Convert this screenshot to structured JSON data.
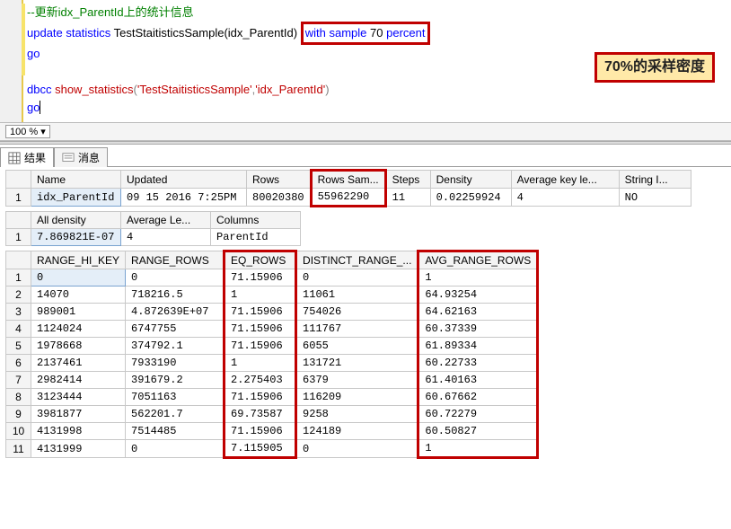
{
  "sql": {
    "comment": "--更新idx_ParentId上的统计信息",
    "l2_update": "update",
    "l2_statistics": "statistics",
    "l2_obj": "TestStaitisticsSample(idx_ParentId)",
    "l2_with": "with",
    "l2_sample": "sample",
    "l2_num": "70",
    "l2_percent": "percent",
    "l3_go": "go",
    "l4_dbcc": "dbcc",
    "l4_fn": "show_statistics",
    "l4_p": "(",
    "l4_s1": "'TestStaitisticsSample'",
    "l4_c": ",",
    "l4_s2": "'idx_ParentId'",
    "l4_p2": ")",
    "l5_go": "go"
  },
  "callout": "70%的采样密度",
  "zoom": "100 %",
  "tabs": {
    "results": "结果",
    "messages": "消息"
  },
  "grid1": {
    "headers": [
      "Name",
      "Updated",
      "Rows",
      "Rows Sam...",
      "Steps",
      "Density",
      "Average key le...",
      "String I..."
    ],
    "rows": [
      [
        "idx_ParentId",
        "09 15 2016  7:25PM",
        "80020380",
        "55962290",
        "11",
        "0.02259924",
        "4",
        "NO"
      ]
    ]
  },
  "grid2": {
    "headers": [
      "All density",
      "Average Le...",
      "Columns"
    ],
    "rows": [
      [
        "7.869821E-07",
        "4",
        "ParentId"
      ]
    ]
  },
  "grid3": {
    "headers": [
      "RANGE_HI_KEY",
      "RANGE_ROWS",
      "EQ_ROWS",
      "DISTINCT_RANGE_...",
      "AVG_RANGE_ROWS"
    ],
    "rows": [
      [
        "0",
        "0",
        "71.15906",
        "0",
        "1"
      ],
      [
        "14070",
        "718216.5",
        "1",
        "11061",
        "64.93254"
      ],
      [
        "989001",
        "4.872639E+07",
        "71.15906",
        "754026",
        "64.62163"
      ],
      [
        "1124024",
        "6747755",
        "71.15906",
        "111767",
        "60.37339"
      ],
      [
        "1978668",
        "374792.1",
        "71.15906",
        "6055",
        "61.89334"
      ],
      [
        "2137461",
        "7933190",
        "1",
        "131721",
        "60.22733"
      ],
      [
        "2982414",
        "391679.2",
        "2.275403",
        "6379",
        "61.40163"
      ],
      [
        "3123444",
        "7051163",
        "71.15906",
        "116209",
        "60.67662"
      ],
      [
        "3981877",
        "562201.7",
        "69.73587",
        "9258",
        "60.72279"
      ],
      [
        "4131998",
        "7514485",
        "71.15906",
        "124189",
        "60.50827"
      ],
      [
        "4131999",
        "0",
        "7.115905",
        "0",
        "1"
      ]
    ]
  },
  "chart_data": {
    "type": "table",
    "stats_header": {
      "Name": "idx_ParentId",
      "Updated": "09 15 2016 7:25PM",
      "Rows": 80020380,
      "Rows Sampled": 55962290,
      "Steps": 11,
      "Density": 0.02259924,
      "Average key length": 4,
      "String Index": "NO"
    },
    "density_vector": {
      "All density": 7.869821e-07,
      "Average Length": 4,
      "Columns": "ParentId"
    },
    "histogram": [
      {
        "RANGE_HI_KEY": 0,
        "RANGE_ROWS": 0,
        "EQ_ROWS": 71.15906,
        "DISTINCT_RANGE_ROWS": 0,
        "AVG_RANGE_ROWS": 1
      },
      {
        "RANGE_HI_KEY": 14070,
        "RANGE_ROWS": 718216.5,
        "EQ_ROWS": 1,
        "DISTINCT_RANGE_ROWS": 11061,
        "AVG_RANGE_ROWS": 64.93254
      },
      {
        "RANGE_HI_KEY": 989001,
        "RANGE_ROWS": 48726390.0,
        "EQ_ROWS": 71.15906,
        "DISTINCT_RANGE_ROWS": 754026,
        "AVG_RANGE_ROWS": 64.62163
      },
      {
        "RANGE_HI_KEY": 1124024,
        "RANGE_ROWS": 6747755,
        "EQ_ROWS": 71.15906,
        "DISTINCT_RANGE_ROWS": 111767,
        "AVG_RANGE_ROWS": 60.37339
      },
      {
        "RANGE_HI_KEY": 1978668,
        "RANGE_ROWS": 374792.1,
        "EQ_ROWS": 71.15906,
        "DISTINCT_RANGE_ROWS": 6055,
        "AVG_RANGE_ROWS": 61.89334
      },
      {
        "RANGE_HI_KEY": 2137461,
        "RANGE_ROWS": 7933190,
        "EQ_ROWS": 1,
        "DISTINCT_RANGE_ROWS": 131721,
        "AVG_RANGE_ROWS": 60.22733
      },
      {
        "RANGE_HI_KEY": 2982414,
        "RANGE_ROWS": 391679.2,
        "EQ_ROWS": 2.275403,
        "DISTINCT_RANGE_ROWS": 6379,
        "AVG_RANGE_ROWS": 61.40163
      },
      {
        "RANGE_HI_KEY": 3123444,
        "RANGE_ROWS": 7051163,
        "EQ_ROWS": 71.15906,
        "DISTINCT_RANGE_ROWS": 116209,
        "AVG_RANGE_ROWS": 60.67662
      },
      {
        "RANGE_HI_KEY": 3981877,
        "RANGE_ROWS": 562201.7,
        "EQ_ROWS": 69.73587,
        "DISTINCT_RANGE_ROWS": 9258,
        "AVG_RANGE_ROWS": 60.72279
      },
      {
        "RANGE_HI_KEY": 4131998,
        "RANGE_ROWS": 7514485,
        "EQ_ROWS": 71.15906,
        "DISTINCT_RANGE_ROWS": 124189,
        "AVG_RANGE_ROWS": 60.50827
      },
      {
        "RANGE_HI_KEY": 4131999,
        "RANGE_ROWS": 0,
        "EQ_ROWS": 7.115905,
        "DISTINCT_RANGE_ROWS": 0,
        "AVG_RANGE_ROWS": 1
      }
    ]
  }
}
